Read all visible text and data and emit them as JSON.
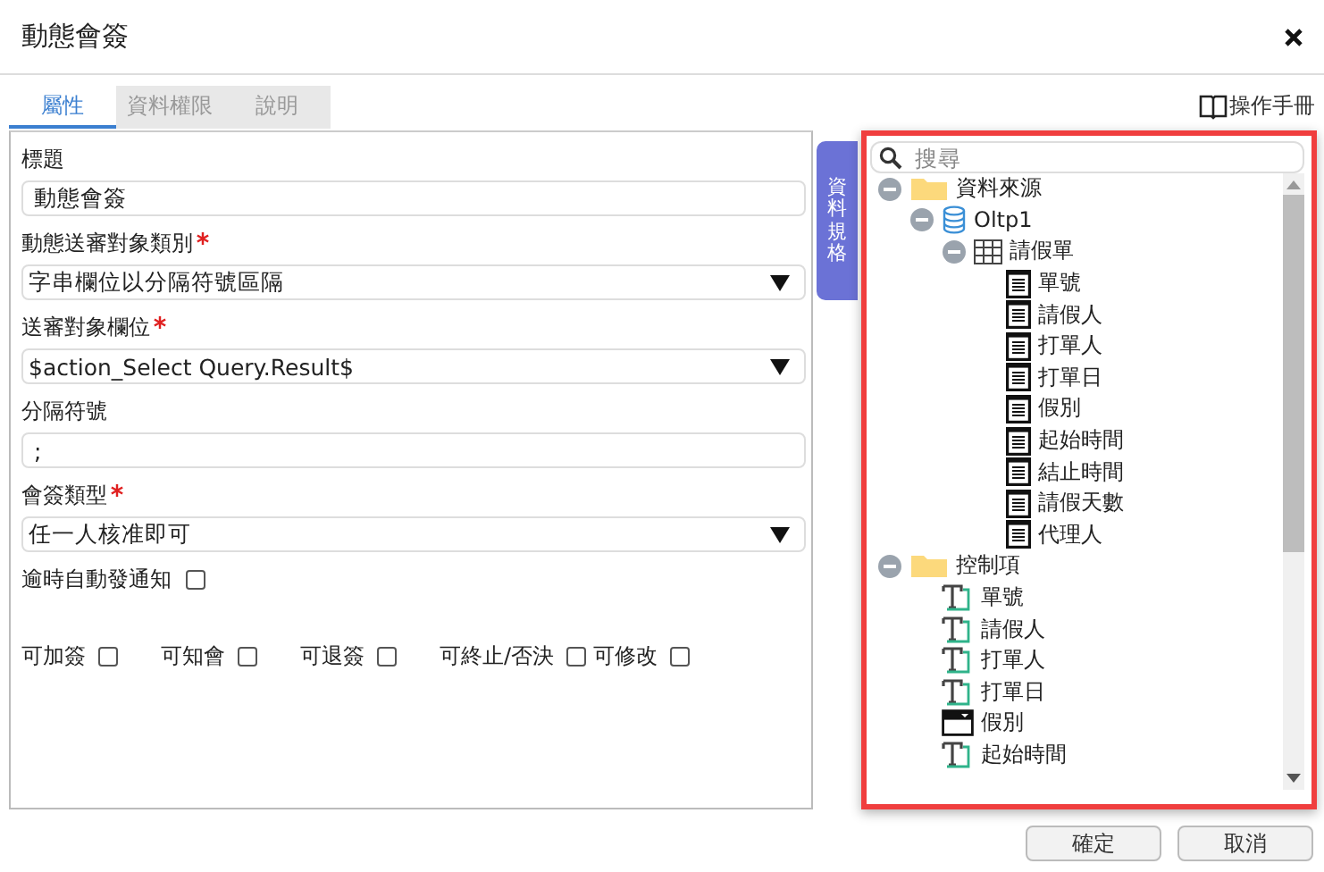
{
  "window": {
    "title": "動態會簽"
  },
  "manual_link": "操作手冊",
  "tabs": [
    {
      "label": "屬性",
      "selected": true
    },
    {
      "label": "資料權限",
      "selected": false
    },
    {
      "label": "說明",
      "selected": false
    }
  ],
  "form": {
    "fields": [
      {
        "kind": "text",
        "label": "標題",
        "required": false,
        "value": "動態會簽"
      },
      {
        "kind": "select",
        "label": "動態送審對象類別",
        "required": true,
        "value": "字串欄位以分隔符號區隔"
      },
      {
        "kind": "select",
        "label": "送審對象欄位",
        "required": true,
        "value": "$action_Select Query.Result$"
      },
      {
        "kind": "text",
        "label": "分隔符號",
        "required": false,
        "value": ";"
      },
      {
        "kind": "select",
        "label": "會簽類型",
        "required": true,
        "value": "任一人核准即可"
      }
    ],
    "notify": {
      "label": "逾時自動發通知",
      "checked": false
    },
    "options": [
      {
        "label": "可加簽",
        "checked": false
      },
      {
        "label": "可知會",
        "checked": false
      },
      {
        "label": "可退簽",
        "checked": false
      },
      {
        "label": "可終止/否決",
        "checked": false
      },
      {
        "label": "可修改",
        "checked": false
      }
    ]
  },
  "side_tab": "資料規格",
  "tree": {
    "search_placeholder": "搜尋",
    "items": [
      {
        "kind": "folder",
        "label": "資料來源",
        "expanded": true,
        "children": [
          {
            "kind": "database",
            "label": "Oltp1",
            "expanded": true,
            "children": [
              {
                "kind": "table",
                "label": "請假單",
                "expanded": true,
                "children": [
                  {
                    "kind": "field",
                    "label": "單號"
                  },
                  {
                    "kind": "field",
                    "label": "請假人"
                  },
                  {
                    "kind": "field",
                    "label": "打單人"
                  },
                  {
                    "kind": "field",
                    "label": "打單日"
                  },
                  {
                    "kind": "field",
                    "label": "假別"
                  },
                  {
                    "kind": "field",
                    "label": "起始時間"
                  },
                  {
                    "kind": "field",
                    "label": "結止時間"
                  },
                  {
                    "kind": "field",
                    "label": "請假天數"
                  },
                  {
                    "kind": "field",
                    "label": "代理人"
                  }
                ]
              }
            ]
          }
        ]
      },
      {
        "kind": "folder",
        "label": "控制項",
        "expanded": true,
        "children": [
          {
            "kind": "textbox",
            "label": "單號"
          },
          {
            "kind": "textbox",
            "label": "請假人"
          },
          {
            "kind": "textbox",
            "label": "打單人"
          },
          {
            "kind": "textbox",
            "label": "打單日"
          },
          {
            "kind": "dropdown",
            "label": "假別"
          },
          {
            "kind": "textbox",
            "label": "起始時間"
          }
        ]
      }
    ]
  },
  "buttons": [
    {
      "label": "確定"
    },
    {
      "label": "取消"
    }
  ]
}
